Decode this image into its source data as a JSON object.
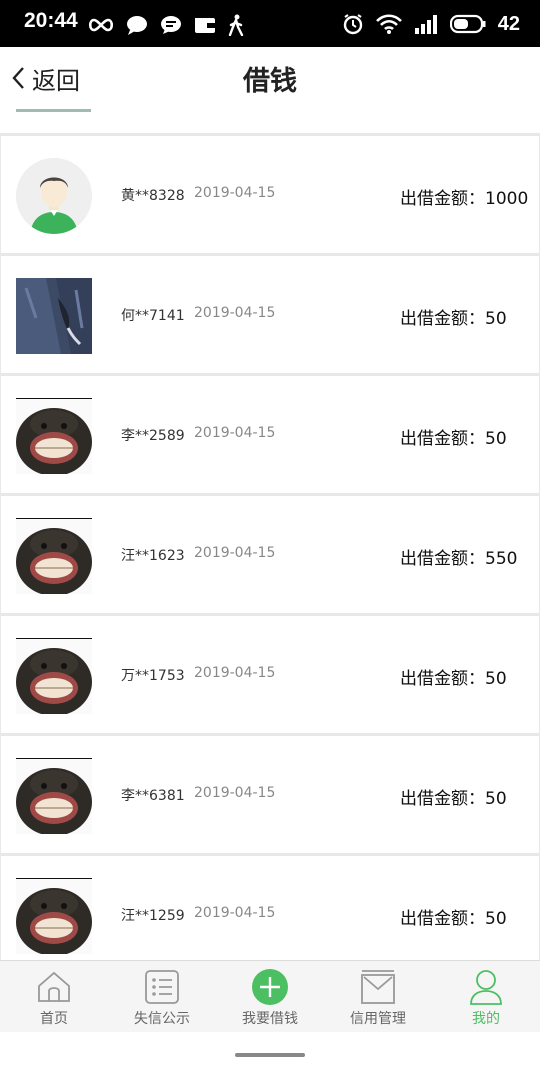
{
  "status_bar": {
    "time": "20:44",
    "battery_level": "42"
  },
  "header": {
    "back_label": "返回",
    "title": "借钱"
  },
  "list": {
    "amount_label": "出借金额：",
    "items": [
      {
        "name": "黄**8328",
        "date": "2019-04-15",
        "amount": "1000",
        "avatar": "default-person-avatar"
      },
      {
        "name": "何**7141",
        "date": "2019-04-15",
        "amount": "50",
        "avatar": "jeans-photo-avatar"
      },
      {
        "name": "李**2589",
        "date": "2019-04-15",
        "amount": "50",
        "avatar": "chimp-photo-avatar"
      },
      {
        "name": "汪**1623",
        "date": "2019-04-15",
        "amount": "550",
        "avatar": "chimp-photo-avatar"
      },
      {
        "name": "万**1753",
        "date": "2019-04-15",
        "amount": "50",
        "avatar": "chimp-photo-avatar"
      },
      {
        "name": "李**6381",
        "date": "2019-04-15",
        "amount": "50",
        "avatar": "chimp-photo-avatar"
      },
      {
        "name": "汪**1259",
        "date": "2019-04-15",
        "amount": "50",
        "avatar": "chimp-photo-avatar"
      }
    ]
  },
  "bottom_nav": {
    "items": [
      {
        "label": "首页",
        "icon": "home-icon"
      },
      {
        "label": "失信公示",
        "icon": "list-icon"
      },
      {
        "label": "我要借钱",
        "icon": "plus-circle-icon"
      },
      {
        "label": "信用管理",
        "icon": "inbox-icon"
      },
      {
        "label": "我的",
        "icon": "user-icon"
      }
    ],
    "active_index": 4
  },
  "colors": {
    "accent_green": "#4cbf63",
    "text_dark": "#222222",
    "text_muted": "#888888"
  }
}
